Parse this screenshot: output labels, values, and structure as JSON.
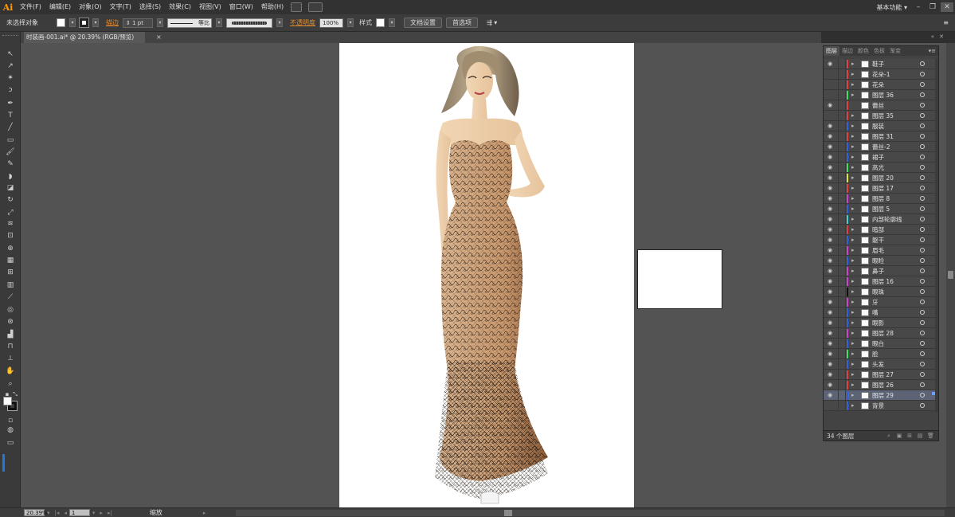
{
  "app": {
    "logo": "Ai"
  },
  "menu": [
    "文件(F)",
    "编辑(E)",
    "对象(O)",
    "文字(T)",
    "选择(S)",
    "效果(C)",
    "视图(V)",
    "窗口(W)",
    "帮助(H)"
  ],
  "workspace": {
    "label": "基本功能",
    "arrow": "▾"
  },
  "window_controls": [
    "–",
    "❐",
    "✕"
  ],
  "control_bar": {
    "selection": "未选择对象",
    "stroke_label": "描边",
    "stroke_weight": "1 pt",
    "stroke_profile": "等比",
    "opacity_label": "不透明度",
    "opacity_value": "100%",
    "style_label": "样式",
    "doc_setup": "文档设置",
    "preferences": "首选项"
  },
  "document": {
    "tab_title": "时装画-001.ai* @ 20.39% (RGB/预览)",
    "close": "×"
  },
  "status_bar": {
    "zoom": "20.39%",
    "artboard": "1",
    "tool_label": "缩放"
  },
  "layers_panel": {
    "tabs": [
      "图层",
      "描边",
      "颜色",
      "色板",
      "渐变"
    ],
    "active_tab": "图层",
    "menu": "▾≡",
    "layer_count": "34 个图层",
    "layers": [
      {
        "name": "鞋子",
        "color": "#e04040",
        "visible": true,
        "expand": true
      },
      {
        "name": "花朵-1",
        "color": "#e04040",
        "visible": false,
        "expand": true
      },
      {
        "name": "花朵",
        "color": "#e04040",
        "visible": false,
        "expand": true
      },
      {
        "name": "图层 36",
        "color": "#3fe060",
        "visible": false,
        "expand": true
      },
      {
        "name": "蕾丝",
        "color": "#e04040",
        "visible": true,
        "expand": false
      },
      {
        "name": "图层 35",
        "color": "#e04040",
        "visible": false,
        "expand": true
      },
      {
        "name": "服装",
        "color": "#3060e0",
        "visible": true,
        "expand": true
      },
      {
        "name": "图层 31",
        "color": "#e04040",
        "visible": true,
        "expand": true
      },
      {
        "name": "蕾丝-2",
        "color": "#3060e0",
        "visible": true,
        "expand": true
      },
      {
        "name": "裙子",
        "color": "#3060e0",
        "visible": true,
        "expand": true
      },
      {
        "name": "高光",
        "color": "#3fe060",
        "visible": true,
        "expand": true
      },
      {
        "name": "图层 20",
        "color": "#e0e040",
        "visible": true,
        "expand": true
      },
      {
        "name": "图层 17",
        "color": "#e04040",
        "visible": true,
        "expand": true
      },
      {
        "name": "图层 8",
        "color": "#d040d0",
        "visible": true,
        "expand": true
      },
      {
        "name": "图层 5",
        "color": "#3060e0",
        "visible": true,
        "expand": true
      },
      {
        "name": "内部轮廓线",
        "color": "#40d0d0",
        "visible": true,
        "expand": true
      },
      {
        "name": "暗部",
        "color": "#e04040",
        "visible": true,
        "expand": true
      },
      {
        "name": "躯干",
        "color": "#3060e0",
        "visible": true,
        "expand": true
      },
      {
        "name": "眉毛",
        "color": "#d040d0",
        "visible": true,
        "expand": true
      },
      {
        "name": "眼睑",
        "color": "#3060e0",
        "visible": true,
        "expand": true
      },
      {
        "name": "鼻子",
        "color": "#d040d0",
        "visible": true,
        "expand": true
      },
      {
        "name": "图层 16",
        "color": "#d040d0",
        "visible": true,
        "expand": true
      },
      {
        "name": "眼珠",
        "color": "#111111",
        "visible": true,
        "expand": true
      },
      {
        "name": "牙",
        "color": "#d040d0",
        "visible": true,
        "expand": true
      },
      {
        "name": "嘴",
        "color": "#3060e0",
        "visible": true,
        "expand": true
      },
      {
        "name": "眼影",
        "color": "#3060e0",
        "visible": true,
        "expand": true
      },
      {
        "name": "图层 28",
        "color": "#d040d0",
        "visible": true,
        "expand": true
      },
      {
        "name": "眼白",
        "color": "#3060e0",
        "visible": true,
        "expand": true
      },
      {
        "name": "脸",
        "color": "#3fe060",
        "visible": true,
        "expand": true
      },
      {
        "name": "头发",
        "color": "#3060e0",
        "visible": true,
        "expand": true
      },
      {
        "name": "图层 27",
        "color": "#e04040",
        "visible": true,
        "expand": true
      },
      {
        "name": "图层 26",
        "color": "#e04040",
        "visible": true,
        "expand": true
      },
      {
        "name": "图层 29",
        "color": "#3060e0",
        "visible": true,
        "expand": true,
        "selected": true
      },
      {
        "name": "背景",
        "color": "#3060e0",
        "visible": false,
        "expand": true
      }
    ]
  }
}
